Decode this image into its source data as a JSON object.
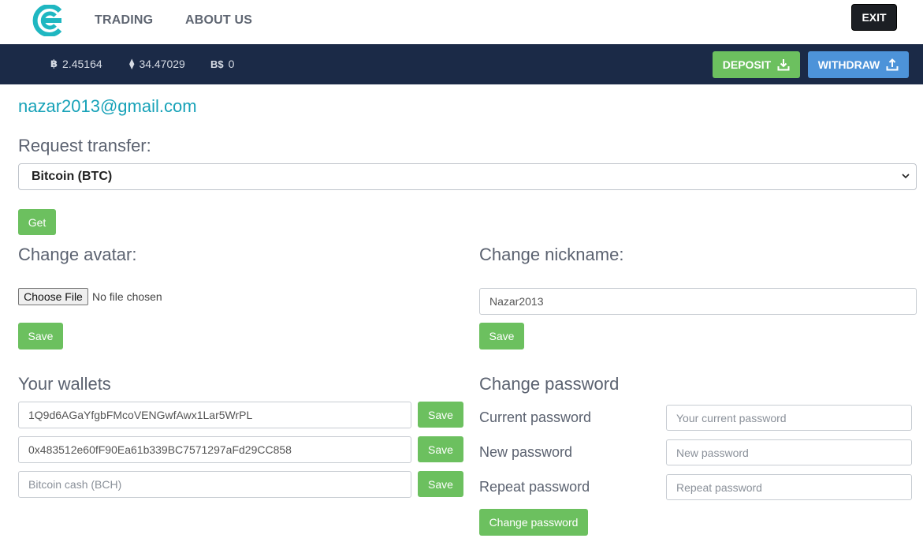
{
  "nav": {
    "logo_icon": "cex-logo-icon",
    "links": [
      "TRADING",
      "ABOUT US"
    ],
    "exit_label": "EXIT"
  },
  "balances": [
    {
      "icon": "bitcoin-icon",
      "symbol": "฿",
      "value": "2.45164"
    },
    {
      "icon": "ethereum-icon",
      "symbol": "⧫",
      "value": "34.47029"
    },
    {
      "icon": "bitcoin-cash-icon",
      "symbol": "B$",
      "value": "0"
    }
  ],
  "actions": {
    "deposit_label": "DEPOSIT",
    "withdraw_label": "WITHDRAW"
  },
  "user": {
    "email": "nazar2013@gmail.com"
  },
  "transfer": {
    "heading": "Request transfer:",
    "selected": "Bitcoin (BTC)",
    "get_label": "Get"
  },
  "avatar": {
    "heading": "Change avatar:",
    "choose_label": "Choose File",
    "file_status": "No file chosen",
    "save_label": "Save"
  },
  "nickname": {
    "heading": "Change nickname:",
    "value": "Nazar2013",
    "save_label": "Save"
  },
  "wallets": {
    "heading": "Your wallets",
    "items": [
      {
        "value": "1Q9d6AGaYfgbFMcoVENGwfAwx1Lar5WrPL",
        "placeholder": "",
        "save_label": "Save"
      },
      {
        "value": "0x483512e60fF90Ea61b339BC7571297aFd29CC858",
        "placeholder": "",
        "save_label": "Save"
      },
      {
        "value": "",
        "placeholder": "Bitcoin cash (BCH)",
        "save_label": "Save"
      }
    ]
  },
  "password": {
    "heading": "Change password",
    "fields": [
      {
        "label": "Current password",
        "placeholder": "Your current password"
      },
      {
        "label": "New password",
        "placeholder": "New password"
      },
      {
        "label": "Repeat password",
        "placeholder": "Repeat password"
      }
    ],
    "submit_label": "Change password"
  },
  "colors": {
    "accent_teal": "#17a2b8",
    "nav_dark": "#1b2a47",
    "green": "#6cc05f",
    "blue": "#4d93d9"
  }
}
